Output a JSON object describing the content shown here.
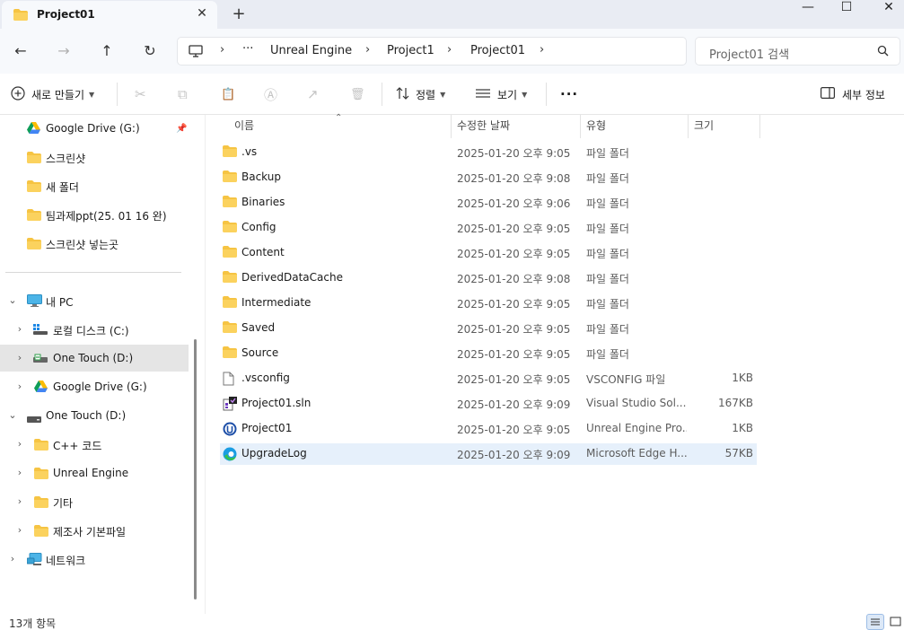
{
  "tab": {
    "title": "Project01",
    "close_glyph": "✕",
    "new_glyph": "+"
  },
  "window": {
    "minimize_glyph": "—",
    "maximize_glyph": "☐",
    "close_glyph": "✕"
  },
  "nav": {
    "back_glyph": "←",
    "forward_glyph": "→",
    "up_glyph": "↑",
    "refresh_glyph": "↻"
  },
  "address": {
    "more_glyph": "···",
    "crumbs": [
      "Unreal Engine",
      "Project1",
      "Project01"
    ],
    "sep_glyph": "›"
  },
  "search": {
    "placeholder": "Project01 검색"
  },
  "toolbar": {
    "new_label": "새로 만들기",
    "sort_label": "정렬",
    "view_label": "보기",
    "more_glyph": "···",
    "details_label": "세부 정보",
    "cut_glyph": "✂",
    "copy_glyph": "⧉",
    "paste_glyph": "📋",
    "rename_glyph": "Ⓐ",
    "share_glyph": "↗",
    "delete_glyph": "🗑"
  },
  "sidebar": {
    "quick": [
      {
        "label": "Google Drive (G:)",
        "icon": "google-drive-icon",
        "pinned": true
      },
      {
        "label": "스크린샷",
        "icon": "folder-icon"
      },
      {
        "label": "새 폴더",
        "icon": "folder-icon"
      },
      {
        "label": "팀과제ppt(25. 01 16 완)",
        "icon": "folder-icon"
      },
      {
        "label": "스크린샷 넣는곳",
        "icon": "folder-icon"
      }
    ],
    "tree": [
      {
        "label": "내 PC",
        "icon": "pc-icon",
        "expanded": true
      },
      {
        "label": "로컬 디스크 (C:)",
        "icon": "local-disk-icon"
      },
      {
        "label": "One Touch (D:)",
        "icon": "external-drive-icon",
        "selected": true
      },
      {
        "label": "Google Drive (G:)",
        "icon": "google-drive-icon"
      },
      {
        "label": "One Touch (D:)",
        "icon": "drive-icon",
        "expanded": true
      },
      {
        "label": "C++ 코드",
        "icon": "folder-icon"
      },
      {
        "label": "Unreal Engine",
        "icon": "folder-icon"
      },
      {
        "label": "기타",
        "icon": "folder-icon"
      },
      {
        "label": "제조사 기본파일",
        "icon": "folder-icon"
      },
      {
        "label": "네트워크",
        "icon": "network-icon"
      }
    ]
  },
  "columns": {
    "name": "이름",
    "date": "수정한 날짜",
    "type": "유형",
    "size": "크기"
  },
  "files": [
    {
      "name": ".vs",
      "date": "2025-01-20 오후 9:05",
      "type": "파일 폴더",
      "size": "",
      "icon": "folder-icon"
    },
    {
      "name": "Backup",
      "date": "2025-01-20 오후 9:08",
      "type": "파일 폴더",
      "size": "",
      "icon": "folder-icon"
    },
    {
      "name": "Binaries",
      "date": "2025-01-20 오후 9:06",
      "type": "파일 폴더",
      "size": "",
      "icon": "folder-icon"
    },
    {
      "name": "Config",
      "date": "2025-01-20 오후 9:05",
      "type": "파일 폴더",
      "size": "",
      "icon": "folder-icon"
    },
    {
      "name": "Content",
      "date": "2025-01-20 오후 9:05",
      "type": "파일 폴더",
      "size": "",
      "icon": "folder-icon"
    },
    {
      "name": "DerivedDataCache",
      "date": "2025-01-20 오후 9:08",
      "type": "파일 폴더",
      "size": "",
      "icon": "folder-icon"
    },
    {
      "name": "Intermediate",
      "date": "2025-01-20 오후 9:05",
      "type": "파일 폴더",
      "size": "",
      "icon": "folder-icon"
    },
    {
      "name": "Saved",
      "date": "2025-01-20 오후 9:05",
      "type": "파일 폴더",
      "size": "",
      "icon": "folder-icon"
    },
    {
      "name": "Source",
      "date": "2025-01-20 오후 9:05",
      "type": "파일 폴더",
      "size": "",
      "icon": "folder-icon"
    },
    {
      "name": ".vsconfig",
      "date": "2025-01-20 오후 9:05",
      "type": "VSCONFIG 파일",
      "size": "1KB",
      "icon": "file-icon"
    },
    {
      "name": "Project01.sln",
      "date": "2025-01-20 오후 9:09",
      "type": "Visual Studio Sol...",
      "size": "167KB",
      "icon": "visual-studio-icon"
    },
    {
      "name": "Project01",
      "date": "2025-01-20 오후 9:05",
      "type": "Unreal Engine Pro...",
      "size": "1KB",
      "icon": "unreal-engine-icon"
    },
    {
      "name": "UpgradeLog",
      "date": "2025-01-20 오후 9:09",
      "type": "Microsoft Edge H...",
      "size": "57KB",
      "icon": "edge-icon",
      "selected": true
    }
  ],
  "status": {
    "count": "13개 항목"
  },
  "colors": {
    "folder": "#f6c443",
    "folder_dark": "#e6a92a",
    "selection": "#e6f0fb",
    "nav_selected": "#e5e5e5",
    "accent": "#0067c0"
  }
}
